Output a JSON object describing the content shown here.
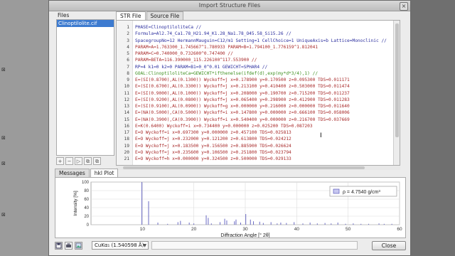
{
  "window": {
    "title": "Import Structure Files",
    "close_glyph": "×"
  },
  "left_strip": {
    "marks": [
      "⊠",
      "⊠",
      "⊠",
      "⊠"
    ]
  },
  "files": {
    "label": "Files",
    "items": [
      "Clinoptilolite.cif"
    ]
  },
  "files_toolbar": {
    "buttons": [
      "+",
      "−",
      "▷",
      "⧉",
      "⧉"
    ]
  },
  "top_tabs": [
    "STR File",
    "Source File"
  ],
  "editor": {
    "lines": [
      {
        "n": "1",
        "text": "PHASE=ClinoptiloliteCa //",
        "c": ""
      },
      {
        "n": "2",
        "text": "Formula=Al2.74_Ca1.78_H21.94_K1.28_Na1.78_O45.58_Si15.26 //",
        "c": ""
      },
      {
        "n": "3",
        "text": "SpacegroupNo=12 HermannMauguin=C12/m1 Setting=1 CellChoice=1 UniqueAxis=b Lattice=Monoclinic //",
        "c": ""
      },
      {
        "n": "4",
        "text": "PARAM=A=1.763300_1.745667^1.780933 PARAM=B=1.794100_1.776159^1.812041",
        "c": "r"
      },
      {
        "n": "5",
        "text": "PARAM=C=0.740000_0.732600^0.747400 //",
        "c": "r"
      },
      {
        "n": "6",
        "text": "PARAM=BETA=116.390000_115.226100^117.553900 //",
        "c": "r"
      },
      {
        "n": "7",
        "text": "RP=4 k1=0 k2=0 PARAM=B1=0_0^0.01 GEWICHT=SPHAR4 //",
        "c": ""
      },
      {
        "n": "8",
        "text": "GOAL:ClinoptiloliteCa=GEWICHT*ifthenelse(ifdef(d),exp(my*d*3/4),1) //",
        "c": "g"
      },
      {
        "n": "9",
        "text": "E=(SI(0.8700),AL(0.1300)) Wyckoff=j x=0.178900 y=0.170500 z=0.095300 TDS=0.011171",
        "c": "r"
      },
      {
        "n": "10",
        "text": "E=(SI(0.6700),AL(0.3300)) Wyckoff=j x=0.213100 y=0.410400 z=0.503000 TDS=0.011474",
        "c": "r"
      },
      {
        "n": "11",
        "text": "E=(SI(0.9000),AL(0.1000)) Wyckoff=j x=0.208000 y=0.190700 z=0.715200 TDS=0.011237",
        "c": "r"
      },
      {
        "n": "12",
        "text": "E=(SI(0.9200),AL(0.0800)) Wyckoff=j x=0.065400 y=0.298900 z=0.412900 TDS=0.011283",
        "c": "r"
      },
      {
        "n": "13",
        "text": "E=(SI(0.9100),AL(0.0900)) Wyckoff=g x=0.000000 y=0.216000 z=0.000000 TDS=0.011640",
        "c": "r"
      },
      {
        "n": "14",
        "text": "E=(NA(0.5000),CA(0.5000)) Wyckoff=i x=0.147800 y=0.000000 z=0.666100 TDS=0.058006",
        "c": "r"
      },
      {
        "n": "15",
        "text": "E=(NA(0.3900),CA(0.3900)) Wyckoff=i x=0.540400 y=0.000000 z=0.216700 TDS=0.037669",
        "c": "r"
      },
      {
        "n": "16",
        "text": "E=K(0.6400) Wyckoff=i x=0.734400 y=0.000000 z=0.025200 TDS=0.087203",
        "c": "r"
      },
      {
        "n": "17",
        "text": "E=O Wyckoff=i x=0.697300 y=0.000000 z=0.457100 TDS=0.025813",
        "c": "r"
      },
      {
        "n": "18",
        "text": "E=O Wyckoff=j x=0.232000 y=0.121200 z=0.613800 TDS=0.024212",
        "c": "r"
      },
      {
        "n": "19",
        "text": "E=O Wyckoff=j x=0.183500 y=0.156500 z=0.885900 TDS=0.026624",
        "c": "r"
      },
      {
        "n": "20",
        "text": "E=O Wyckoff=j x=0.235600 y=0.106500 z=0.251800 TDS=0.023794",
        "c": "r"
      },
      {
        "n": "21",
        "text": "E=O Wyckoff=h x=0.000000 y=0.324500 z=0.500000 TDS=0.029133",
        "c": "r"
      }
    ]
  },
  "bottom_tabs": [
    "Messages",
    "hkl Plot"
  ],
  "chart_data": {
    "type": "bar",
    "xlabel": "Diffraction Angle [° 2θ]",
    "ylabel": "Intensity [%]",
    "xlim": [
      0,
      60
    ],
    "ylim": [
      0,
      100
    ],
    "x_ticks": [
      10,
      20,
      30,
      40,
      50,
      60
    ],
    "y_ticks": [
      0,
      20,
      40,
      60,
      80,
      100
    ],
    "grid": true,
    "legend": {
      "placement": "top-right",
      "label": "ρ = 4.7540 g/cm³"
    },
    "series_color": "#5b5bbd",
    "peaks": [
      [
        9.9,
        100
      ],
      [
        11.2,
        55
      ],
      [
        13.0,
        5
      ],
      [
        14.9,
        2
      ],
      [
        16.9,
        6
      ],
      [
        17.4,
        9
      ],
      [
        19.1,
        5
      ],
      [
        20.0,
        3
      ],
      [
        22.4,
        22
      ],
      [
        22.8,
        16
      ],
      [
        23.4,
        3
      ],
      [
        25.1,
        6
      ],
      [
        26.0,
        14
      ],
      [
        26.4,
        10
      ],
      [
        27.9,
        8
      ],
      [
        28.2,
        12
      ],
      [
        29.1,
        5
      ],
      [
        30.1,
        25
      ],
      [
        31.0,
        12
      ],
      [
        31.6,
        8
      ],
      [
        32.8,
        7
      ],
      [
        33.5,
        4
      ],
      [
        35.0,
        6
      ],
      [
        36.2,
        3
      ],
      [
        36.9,
        5
      ],
      [
        38.0,
        4
      ],
      [
        39.5,
        6
      ],
      [
        41.2,
        3
      ],
      [
        42.6,
        5
      ],
      [
        44.0,
        3
      ],
      [
        45.5,
        4
      ],
      [
        46.7,
        3
      ],
      [
        48.0,
        5
      ],
      [
        49.5,
        2
      ],
      [
        51.0,
        3
      ],
      [
        52.5,
        2
      ],
      [
        54.0,
        2
      ],
      [
        56.0,
        3
      ],
      [
        57.0,
        2
      ],
      [
        58.5,
        2
      ]
    ]
  },
  "bottom_bar": {
    "icons": [
      "save-icon",
      "print-icon",
      "image-icon"
    ],
    "radiation": "CuKα₁ (1.540598 Å)",
    "close_label": "Close"
  }
}
